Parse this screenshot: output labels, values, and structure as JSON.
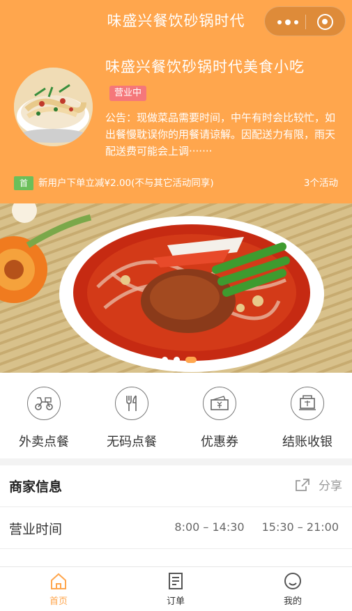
{
  "nav": {
    "title": "味盛兴餐饮砂锅时代"
  },
  "shop": {
    "name": "味盛兴餐饮砂锅时代美食小吃",
    "status": "营业中",
    "notice": "公告：现做菜品需要时间，中午有时会比较忙，如出餐慢耽误你的用餐请谅解。因配送力有限，雨天配送费可能会上调·······"
  },
  "promo": {
    "badge": "首",
    "text": "新用户下单立减¥2.00(不与其它活动同享)",
    "count": "3个活动"
  },
  "banner": {
    "slide_count": 3,
    "active_index": 2
  },
  "quick_actions": [
    {
      "label": "外卖点餐",
      "icon": "scooter-icon"
    },
    {
      "label": "无码点餐",
      "icon": "utensils-icon"
    },
    {
      "label": "优惠券",
      "icon": "coupon-icon"
    },
    {
      "label": "结账收银",
      "icon": "cashier-icon"
    }
  ],
  "merchant": {
    "title": "商家信息",
    "share_label": "分享",
    "hours_label": "营业时间",
    "hours": [
      "8:00 – 14:30",
      "15:30 – 21:00"
    ]
  },
  "tabs": [
    {
      "label": "首页",
      "icon": "home-icon",
      "active": true
    },
    {
      "label": "订单",
      "icon": "orders-icon",
      "active": false
    },
    {
      "label": "我的",
      "icon": "profile-icon",
      "active": false
    }
  ],
  "colors": {
    "brand": "#ffa64d",
    "status_badge": "#f5777a",
    "promo_badge": "#6bbf5a"
  }
}
